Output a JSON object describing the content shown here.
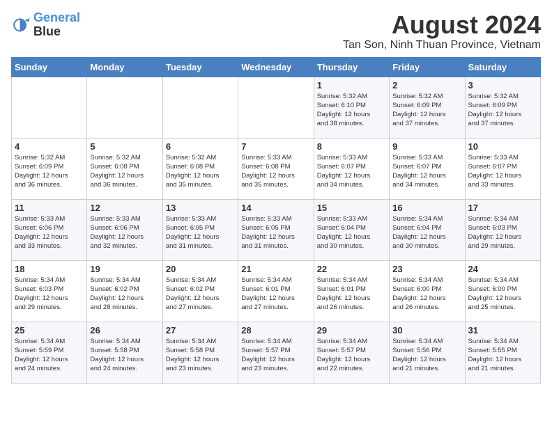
{
  "header": {
    "logo_line1": "General",
    "logo_line2": "Blue",
    "title": "August 2024",
    "subtitle": "Tan Son, Ninh Thuan Province, Vietnam"
  },
  "weekdays": [
    "Sunday",
    "Monday",
    "Tuesday",
    "Wednesday",
    "Thursday",
    "Friday",
    "Saturday"
  ],
  "weeks": [
    [
      {
        "day": "",
        "info": ""
      },
      {
        "day": "",
        "info": ""
      },
      {
        "day": "",
        "info": ""
      },
      {
        "day": "",
        "info": ""
      },
      {
        "day": "1",
        "info": "Sunrise: 5:32 AM\nSunset: 6:10 PM\nDaylight: 12 hours\nand 38 minutes."
      },
      {
        "day": "2",
        "info": "Sunrise: 5:32 AM\nSunset: 6:09 PM\nDaylight: 12 hours\nand 37 minutes."
      },
      {
        "day": "3",
        "info": "Sunrise: 5:32 AM\nSunset: 6:09 PM\nDaylight: 12 hours\nand 37 minutes."
      }
    ],
    [
      {
        "day": "4",
        "info": "Sunrise: 5:32 AM\nSunset: 6:09 PM\nDaylight: 12 hours\nand 36 minutes."
      },
      {
        "day": "5",
        "info": "Sunrise: 5:32 AM\nSunset: 6:08 PM\nDaylight: 12 hours\nand 36 minutes."
      },
      {
        "day": "6",
        "info": "Sunrise: 5:32 AM\nSunset: 6:08 PM\nDaylight: 12 hours\nand 35 minutes."
      },
      {
        "day": "7",
        "info": "Sunrise: 5:33 AM\nSunset: 6:08 PM\nDaylight: 12 hours\nand 35 minutes."
      },
      {
        "day": "8",
        "info": "Sunrise: 5:33 AM\nSunset: 6:07 PM\nDaylight: 12 hours\nand 34 minutes."
      },
      {
        "day": "9",
        "info": "Sunrise: 5:33 AM\nSunset: 6:07 PM\nDaylight: 12 hours\nand 34 minutes."
      },
      {
        "day": "10",
        "info": "Sunrise: 5:33 AM\nSunset: 6:07 PM\nDaylight: 12 hours\nand 33 minutes."
      }
    ],
    [
      {
        "day": "11",
        "info": "Sunrise: 5:33 AM\nSunset: 6:06 PM\nDaylight: 12 hours\nand 33 minutes."
      },
      {
        "day": "12",
        "info": "Sunrise: 5:33 AM\nSunset: 6:06 PM\nDaylight: 12 hours\nand 32 minutes."
      },
      {
        "day": "13",
        "info": "Sunrise: 5:33 AM\nSunset: 6:05 PM\nDaylight: 12 hours\nand 31 minutes."
      },
      {
        "day": "14",
        "info": "Sunrise: 5:33 AM\nSunset: 6:05 PM\nDaylight: 12 hours\nand 31 minutes."
      },
      {
        "day": "15",
        "info": "Sunrise: 5:33 AM\nSunset: 6:04 PM\nDaylight: 12 hours\nand 30 minutes."
      },
      {
        "day": "16",
        "info": "Sunrise: 5:34 AM\nSunset: 6:04 PM\nDaylight: 12 hours\nand 30 minutes."
      },
      {
        "day": "17",
        "info": "Sunrise: 5:34 AM\nSunset: 6:03 PM\nDaylight: 12 hours\nand 29 minutes."
      }
    ],
    [
      {
        "day": "18",
        "info": "Sunrise: 5:34 AM\nSunset: 6:03 PM\nDaylight: 12 hours\nand 29 minutes."
      },
      {
        "day": "19",
        "info": "Sunrise: 5:34 AM\nSunset: 6:02 PM\nDaylight: 12 hours\nand 28 minutes."
      },
      {
        "day": "20",
        "info": "Sunrise: 5:34 AM\nSunset: 6:02 PM\nDaylight: 12 hours\nand 27 minutes."
      },
      {
        "day": "21",
        "info": "Sunrise: 5:34 AM\nSunset: 6:01 PM\nDaylight: 12 hours\nand 27 minutes."
      },
      {
        "day": "22",
        "info": "Sunrise: 5:34 AM\nSunset: 6:01 PM\nDaylight: 12 hours\nand 26 minutes."
      },
      {
        "day": "23",
        "info": "Sunrise: 5:34 AM\nSunset: 6:00 PM\nDaylight: 12 hours\nand 26 minutes."
      },
      {
        "day": "24",
        "info": "Sunrise: 5:34 AM\nSunset: 6:00 PM\nDaylight: 12 hours\nand 25 minutes."
      }
    ],
    [
      {
        "day": "25",
        "info": "Sunrise: 5:34 AM\nSunset: 5:59 PM\nDaylight: 12 hours\nand 24 minutes."
      },
      {
        "day": "26",
        "info": "Sunrise: 5:34 AM\nSunset: 5:58 PM\nDaylight: 12 hours\nand 24 minutes."
      },
      {
        "day": "27",
        "info": "Sunrise: 5:34 AM\nSunset: 5:58 PM\nDaylight: 12 hours\nand 23 minutes."
      },
      {
        "day": "28",
        "info": "Sunrise: 5:34 AM\nSunset: 5:57 PM\nDaylight: 12 hours\nand 23 minutes."
      },
      {
        "day": "29",
        "info": "Sunrise: 5:34 AM\nSunset: 5:57 PM\nDaylight: 12 hours\nand 22 minutes."
      },
      {
        "day": "30",
        "info": "Sunrise: 5:34 AM\nSunset: 5:56 PM\nDaylight: 12 hours\nand 21 minutes."
      },
      {
        "day": "31",
        "info": "Sunrise: 5:34 AM\nSunset: 5:55 PM\nDaylight: 12 hours\nand 21 minutes."
      }
    ]
  ]
}
